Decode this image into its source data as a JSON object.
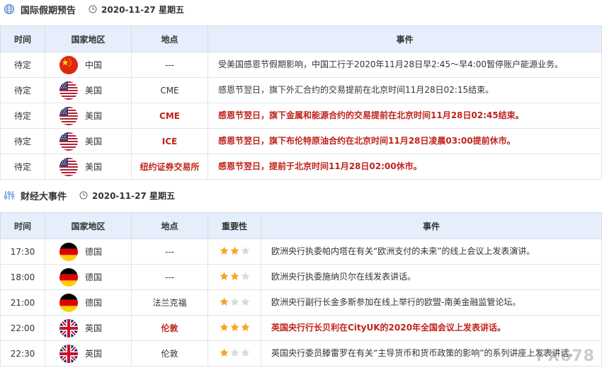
{
  "holidays": {
    "title": "国际假期预告",
    "date": "2020-11-27 星期五",
    "headers": {
      "time": "时间",
      "country": "国家地区",
      "place": "地点",
      "event": "事件"
    },
    "rows": [
      {
        "time": "待定",
        "country": "中国",
        "flag": "cn",
        "place": "---",
        "event": "受美国感恩节假期影响，中国工行于2020年11月28日早2:45～早4:00暂停账户能源业务。",
        "highlight": false
      },
      {
        "time": "待定",
        "country": "美国",
        "flag": "us",
        "place": "CME",
        "event": "感恩节翌日，旗下外汇合约的交易提前在北京时间11月28日02:15结束。",
        "highlight": false
      },
      {
        "time": "待定",
        "country": "美国",
        "flag": "us",
        "place": "CME",
        "event": "感恩节翌日，旗下金属和能源合约的交易提前在北京时间11月28日02:45结束。",
        "highlight": true
      },
      {
        "time": "待定",
        "country": "美国",
        "flag": "us",
        "place": "ICE",
        "event": "感恩节翌日，旗下布伦特原油合约在北京时间11月28日凌晨03:00提前休市。",
        "highlight": true
      },
      {
        "time": "待定",
        "country": "美国",
        "flag": "us",
        "place": "纽约证券交易所",
        "event": "感恩节翌日，提前于北京时间11月28日02:00休市。",
        "highlight": true
      }
    ]
  },
  "events": {
    "title": "财经大事件",
    "date": "2020-11-27 星期五",
    "headers": {
      "time": "时间",
      "country": "国家地区",
      "place": "地点",
      "importance": "重要性",
      "event": "事件"
    },
    "rows": [
      {
        "time": "17:30",
        "country": "德国",
        "flag": "de",
        "place": "---",
        "stars": 2,
        "event": "欧洲央行执委帕内塔在有关“欧洲支付的未来”的线上会议上发表演讲。",
        "highlight": false
      },
      {
        "time": "18:00",
        "country": "德国",
        "flag": "de",
        "place": "---",
        "stars": 2,
        "event": "欧洲央行执委施纳贝尔在线发表讲话。",
        "highlight": false
      },
      {
        "time": "21:00",
        "country": "德国",
        "flag": "de",
        "place": "法兰克福",
        "stars": 1,
        "event": "欧洲央行副行长金多斯参加在线上举行的欧盟-南美金融监管论坛。",
        "highlight": false
      },
      {
        "time": "22:00",
        "country": "英国",
        "flag": "gb",
        "place": "伦敦",
        "stars": 3,
        "event": "英国央行行长贝利在CityUK的2020年全国会议上发表讲话。",
        "highlight": true
      },
      {
        "time": "22:30",
        "country": "英国",
        "flag": "gb",
        "place": "伦敦",
        "stars": 1,
        "event": "英国央行委员滕雷罗在有关“主导货币和货币政策的影响”的系列讲座上发表讲话。",
        "highlight": false
      }
    ]
  },
  "colors": {
    "header_bg": "#e6eefb",
    "highlight": "#c0231c",
    "star_on": "#f5a623",
    "star_off": "#d9d9d9"
  },
  "watermark": "FX678"
}
